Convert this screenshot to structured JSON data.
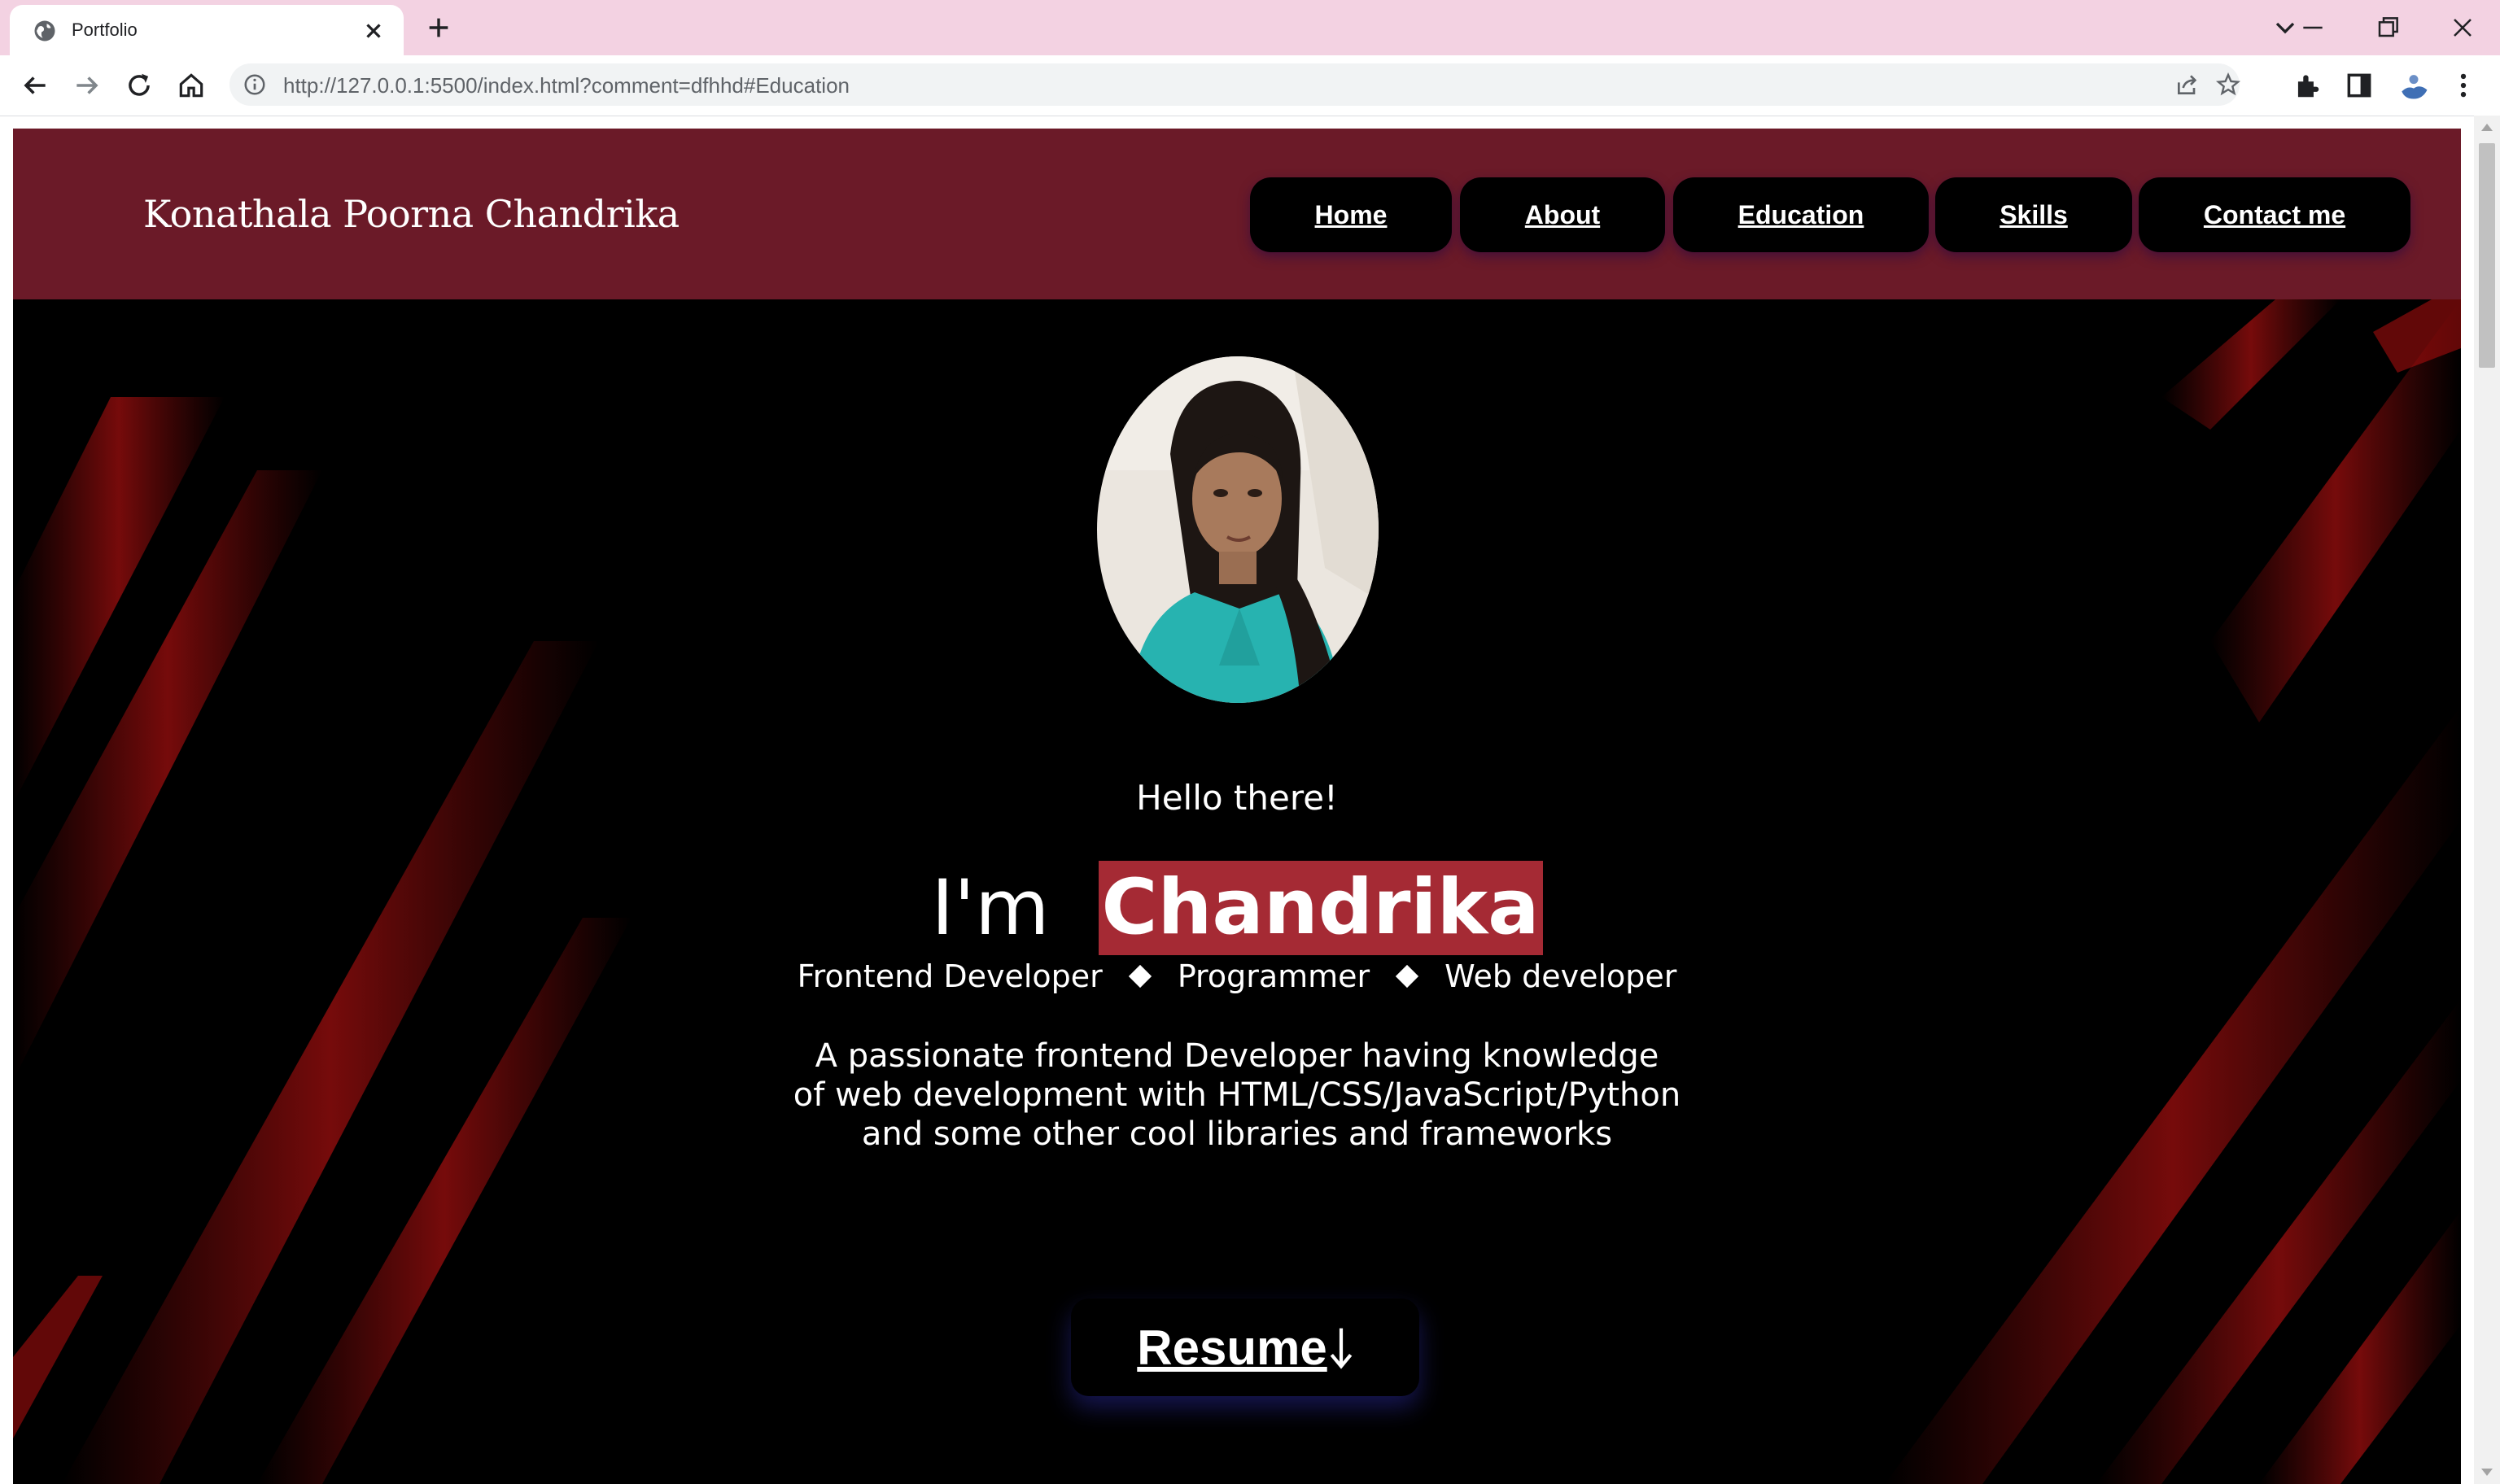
{
  "browser": {
    "tab_title": "Portfolio",
    "url": "http://127.0.0.1:5500/index.html?comment=dfhhd#Education"
  },
  "header": {
    "brand": "Konathala Poorna Chandrika",
    "nav": [
      {
        "label": "Home"
      },
      {
        "label": "About"
      },
      {
        "label": "Education"
      },
      {
        "label": "Skills"
      },
      {
        "label": "Contact me"
      }
    ]
  },
  "hero": {
    "greeting": "Hello there!",
    "intro_prefix": "I'm",
    "name": "Chandrika",
    "roles": [
      "Frontend Developer",
      "Programmer",
      "Web developer"
    ],
    "description_lines": [
      "A passionate frontend Developer having knowledge",
      "of web development with HTML/CSS/JavaScript/Python",
      "and some other cool libraries and frameworks"
    ],
    "resume_label": "Resume"
  },
  "colors": {
    "tabstrip": "#f3d2e2",
    "header_bg": "#6b1a28",
    "name_highlight": "#a52a34",
    "hero_bg": "#000000"
  }
}
